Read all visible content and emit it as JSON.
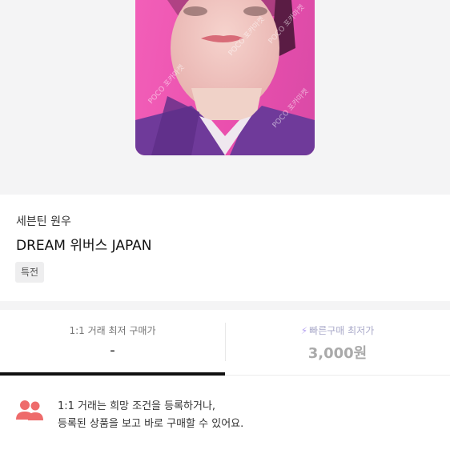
{
  "product": {
    "artist": "세븐틴 원우",
    "title": "DREAM 위버스 JAPAN",
    "badge": "특전",
    "image_watermark": "POCO 포카마켓"
  },
  "price_tabs": [
    {
      "label": "1:1 거래 최저 구매가",
      "value": "-",
      "active": true
    },
    {
      "label": "빠른구매 최저가",
      "value": "3,000원",
      "icon": "lightning-icon",
      "active": false
    }
  ],
  "notice": {
    "icon": "people-icon",
    "line1": "1:1 거래는 희망 조건을 등록하거나,",
    "line2": "등록된 상품을 보고 바로 구매할 수 있어요."
  },
  "colors": {
    "card_pink": "#ea4fae",
    "notice_icon": "#ee6b6b",
    "bolt": "#b7a4f2",
    "active_tab": "#111111"
  }
}
